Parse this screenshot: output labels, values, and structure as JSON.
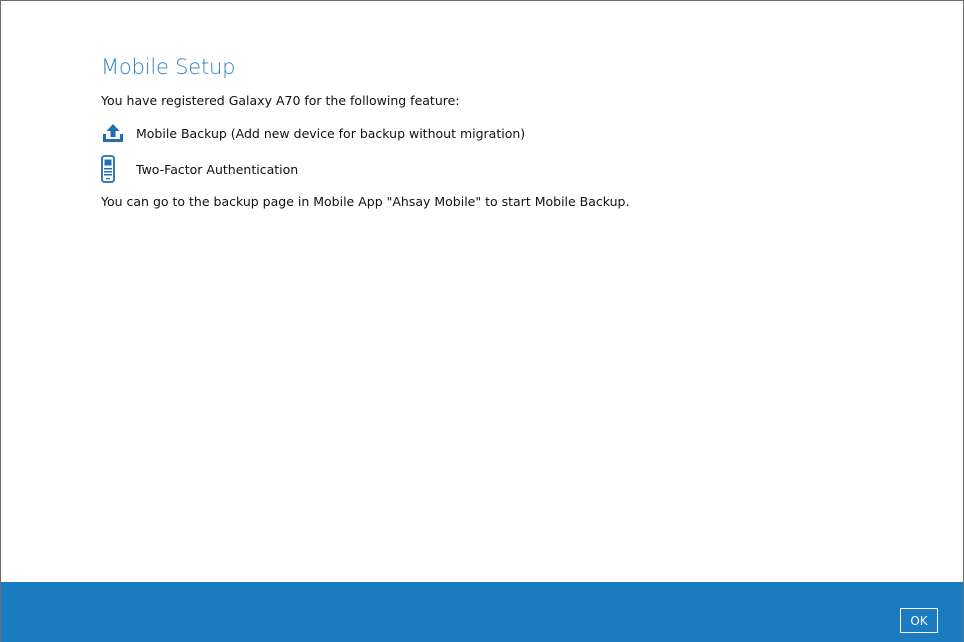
{
  "dialog": {
    "title": "Mobile Setup",
    "intro": "You have registered Galaxy A70 for the following feature:",
    "features": [
      {
        "label": "Mobile Backup (Add new device for backup without migration)",
        "icon": "upload-icon"
      },
      {
        "label": "Two-Factor Authentication",
        "icon": "phone-authenticator-icon"
      }
    ],
    "instruction": "You can go to the backup page in Mobile App \"Ahsay Mobile\" to start Mobile Backup.",
    "ok_label": "OK"
  },
  "colors": {
    "title": "#2f83c6",
    "bottom_bar": "#1a7bc1",
    "icon": "#1f6fb2"
  }
}
